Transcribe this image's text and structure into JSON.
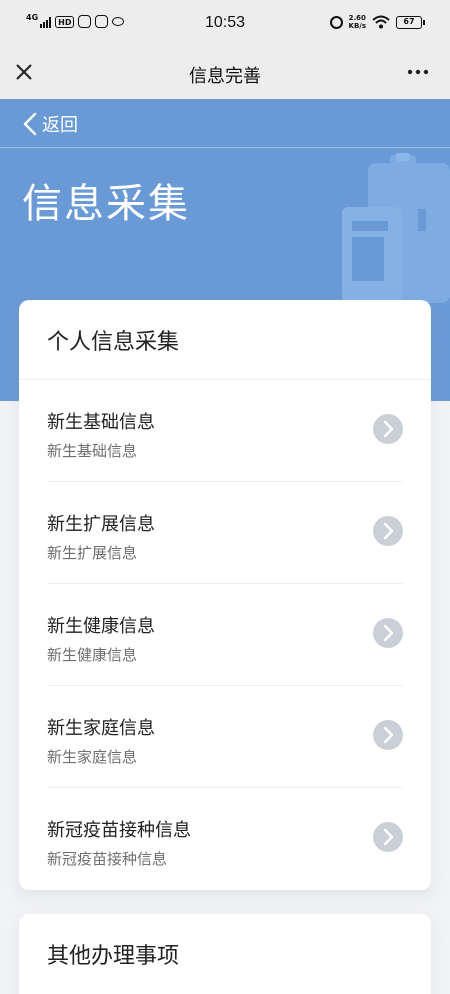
{
  "status_bar": {
    "network": "4G",
    "hd": "HD",
    "time": "10:53",
    "speed_value": "2.60",
    "speed_unit": "KB/s",
    "battery": "67"
  },
  "nav": {
    "title": "信息完善",
    "close_icon": "close-icon",
    "more_icon": "more-icon"
  },
  "header": {
    "back_label": "返回",
    "title": "信息采集",
    "background_color": "#6a9ad6"
  },
  "personal_card": {
    "heading": "个人信息采集",
    "items": [
      {
        "title": "新生基础信息",
        "subtitle": "新生基础信息"
      },
      {
        "title": "新生扩展信息",
        "subtitle": "新生扩展信息"
      },
      {
        "title": "新生健康信息",
        "subtitle": "新生健康信息"
      },
      {
        "title": "新生家庭信息",
        "subtitle": "新生家庭信息"
      },
      {
        "title": "新冠疫苗接种信息",
        "subtitle": "新冠疫苗接种信息"
      }
    ]
  },
  "other_card": {
    "heading": "其他办理事项"
  }
}
